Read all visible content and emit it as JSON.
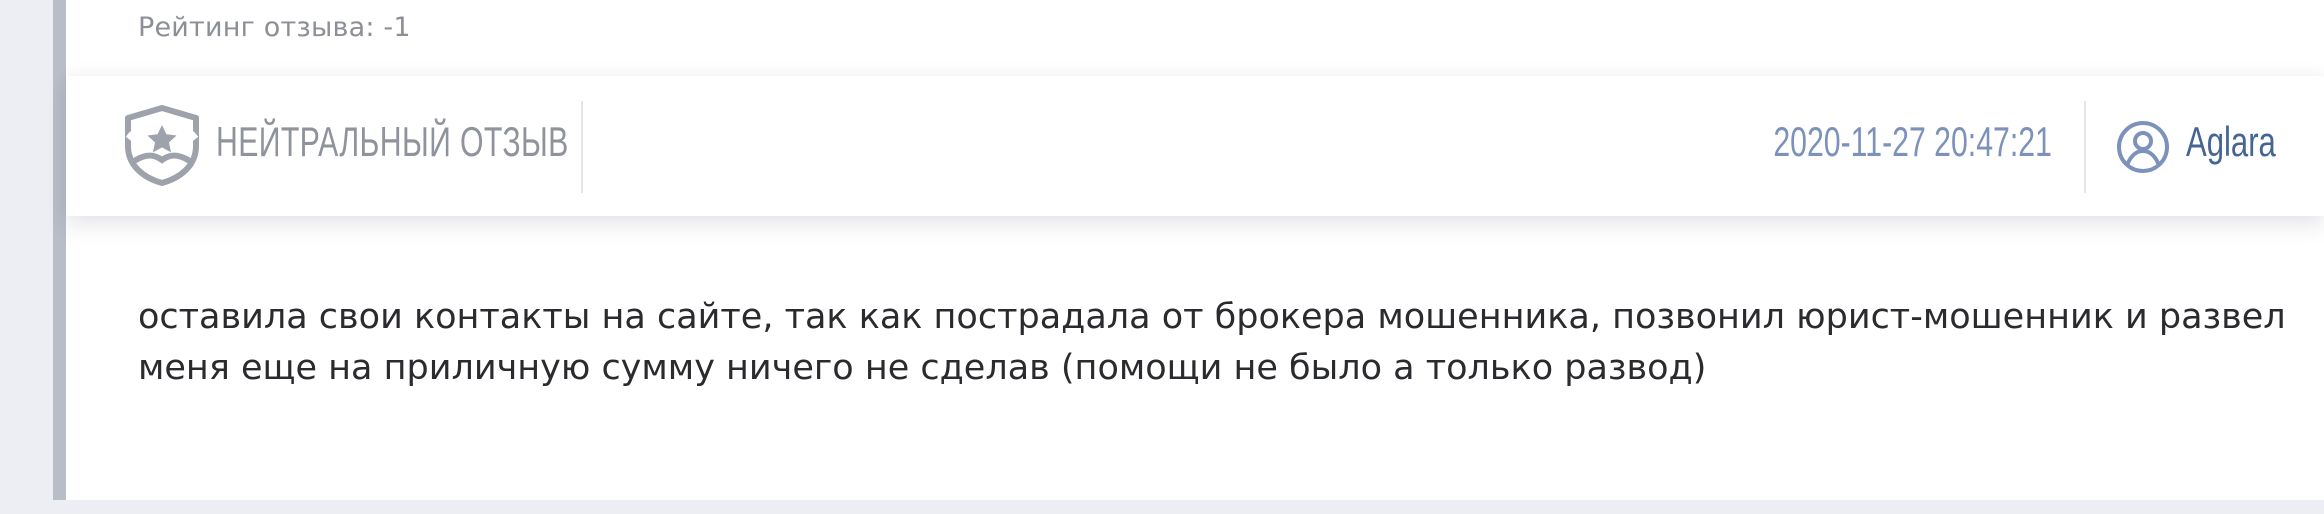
{
  "review": {
    "rating_text": "Рейтинг отзыва: -1",
    "type_label": "НЕЙТРАЛЬНЫЙ ОТЗЫВ",
    "type_icon": "shield-star-icon",
    "date": "2020-11-27 20:47:21",
    "user_icon": "user-circle-icon",
    "author": "Aglara",
    "text": "оставила свои контакты на сайте, так как пострадала от брокера мошенника, позвонил юрист-мошенник и развел меня еще на приличную сумму ничего не сделав (помощи не было а только развод)"
  },
  "colors": {
    "accent_border": "#b9bdc7",
    "label_gray": "#8f939b",
    "date_blue": "#7c92bb",
    "author_blue": "#456594"
  }
}
